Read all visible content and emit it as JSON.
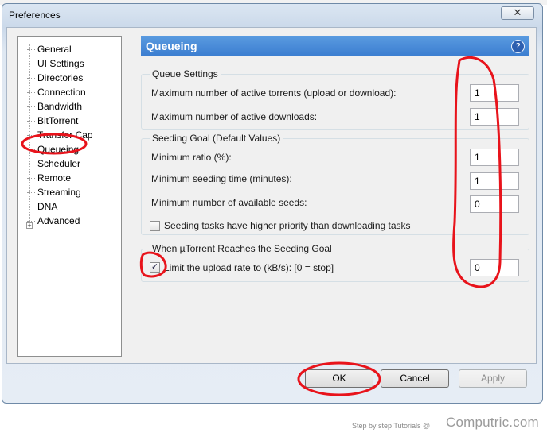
{
  "window": {
    "title": "Preferences",
    "close_glyph": "✕"
  },
  "tree": {
    "items": [
      {
        "label": "General"
      },
      {
        "label": "UI Settings"
      },
      {
        "label": "Directories"
      },
      {
        "label": "Connection"
      },
      {
        "label": "Bandwidth"
      },
      {
        "label": "BitTorrent"
      },
      {
        "label": "Transfer Cap"
      },
      {
        "label": "Queueing"
      },
      {
        "label": "Scheduler"
      },
      {
        "label": "Remote"
      },
      {
        "label": "Streaming"
      },
      {
        "label": "DNA"
      },
      {
        "label": "Advanced"
      }
    ],
    "expand_glyph": "+"
  },
  "panel": {
    "header": "Queueing",
    "help_glyph": "?",
    "queue_settings": {
      "title": "Queue Settings",
      "max_active_torrents_label": "Maximum number of active torrents (upload or download):",
      "max_active_torrents_value": "1",
      "max_active_downloads_label": "Maximum number of active downloads:",
      "max_active_downloads_value": "1"
    },
    "seeding_goal": {
      "title": "Seeding Goal (Default Values)",
      "min_ratio_label": "Minimum ratio (%):",
      "min_ratio_value": "1",
      "min_seed_time_label": "Minimum seeding time (minutes):",
      "min_seed_time_value": "1",
      "min_seeds_label": "Minimum number of available seeds:",
      "min_seeds_value": "0",
      "priority_label": "Seeding tasks have higher priority than downloading tasks",
      "priority_checked": false
    },
    "reaches_goal": {
      "title": "When µTorrent Reaches the Seeding Goal",
      "limit_label": "Limit the upload rate to (kB/s): [0 = stop]",
      "limit_checked": true,
      "check_glyph": "✓",
      "limit_value": "0"
    }
  },
  "buttons": {
    "ok": "OK",
    "cancel": "Cancel",
    "apply": "Apply"
  },
  "watermark": {
    "small": "Step by step Tutorials @",
    "brand": "Computric.com"
  },
  "annotation_color": "#e8131b"
}
